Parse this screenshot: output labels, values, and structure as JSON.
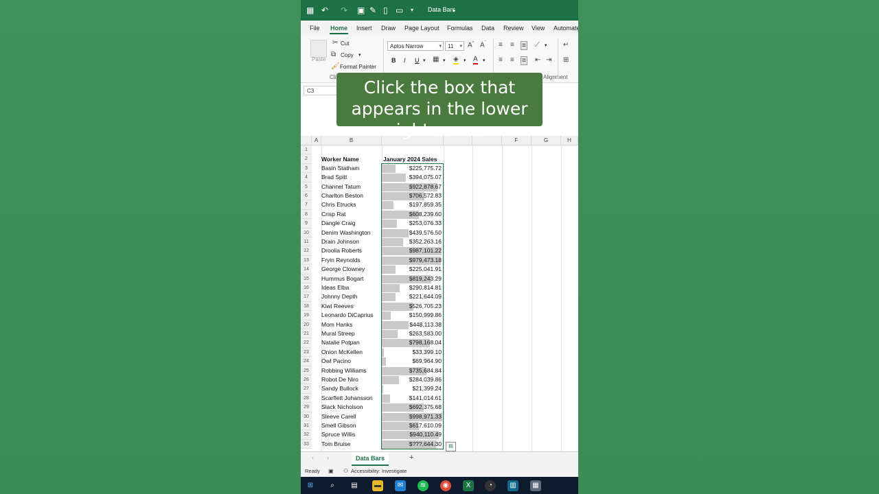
{
  "titlebar": {
    "workbook_title": "Data Bars"
  },
  "menu": {
    "items": [
      "File",
      "Home",
      "Insert",
      "Draw",
      "Page Layout",
      "Formulas",
      "Data",
      "Review",
      "View",
      "Automate"
    ]
  },
  "ribbon": {
    "paste_label": "Paste",
    "cut_label": "Cut",
    "copy_label": "Copy",
    "format_painter_label": "Format Painter",
    "clipboard_group": "Clipboard",
    "font_name": "Aptos Narrow",
    "font_size": "11",
    "alignment_group": "Alignment",
    "bold": "B",
    "italic": "I",
    "underline": "U"
  },
  "namebox": {
    "value": "C3"
  },
  "overlay": {
    "lines": [
      "Click the box that",
      "appears in the lower",
      "right corner"
    ]
  },
  "columns": [
    "A",
    "B",
    "F",
    "G",
    "H"
  ],
  "sheet": {
    "header_b": "Worker Name",
    "header_c": "January 2024 Sales",
    "rows": [
      {
        "name": "Basin Statham",
        "sales": "$225,775.72",
        "v": 225775.72
      },
      {
        "name": "Brad Spitt",
        "sales": "$394,075.07",
        "v": 394075.07
      },
      {
        "name": "Channel Tatum",
        "sales": "$922,878.67",
        "v": 922878.67
      },
      {
        "name": "Charlton Beston",
        "sales": "$706,572.83",
        "v": 706572.83
      },
      {
        "name": "Chris Etrucks",
        "sales": "$197,859.35",
        "v": 197859.35
      },
      {
        "name": "Crisp Rat",
        "sales": "$608,239.60",
        "v": 608239.6
      },
      {
        "name": "Dangle Craig",
        "sales": "$253,076.33",
        "v": 253076.33
      },
      {
        "name": "Denim Washington",
        "sales": "$439,576.50",
        "v": 439576.5
      },
      {
        "name": "Drain Johnson",
        "sales": "$352,263.16",
        "v": 352263.16
      },
      {
        "name": "Droolia Roberts",
        "sales": "$987,101.22",
        "v": 987101.22
      },
      {
        "name": "Fryin Reynolds",
        "sales": "$979,473.18",
        "v": 979473.18
      },
      {
        "name": "George Clowney",
        "sales": "$225,041.91",
        "v": 225041.91
      },
      {
        "name": "Hummus Bogart",
        "sales": "$819,243.29",
        "v": 819243.29
      },
      {
        "name": "Ideas Elba",
        "sales": "$290,814.81",
        "v": 290814.81
      },
      {
        "name": "Johnny Depth",
        "sales": "$221,644.09",
        "v": 221644.09
      },
      {
        "name": "Kiwi Reeves",
        "sales": "$526,705.23",
        "v": 526705.23
      },
      {
        "name": "Leonardo DiCaprius",
        "sales": "$150,999.86",
        "v": 150999.86
      },
      {
        "name": "Mom Hanks",
        "sales": "$448,113.38",
        "v": 448113.38
      },
      {
        "name": "Mural Streep",
        "sales": "$263,583.00",
        "v": 263583.0
      },
      {
        "name": "Natalie Potpan",
        "sales": "$798,168.04",
        "v": 798168.04
      },
      {
        "name": "Onion McKellen",
        "sales": "$33,399.10",
        "v": 33399.1
      },
      {
        "name": "Owl Pacino",
        "sales": "$69,964.90",
        "v": 69964.9
      },
      {
        "name": "Robbing Williams",
        "sales": "$735,684.84",
        "v": 735684.84
      },
      {
        "name": "Robot De Niro",
        "sales": "$284,039.86",
        "v": 284039.86
      },
      {
        "name": "Sandy Bullock",
        "sales": "$21,399.24",
        "v": 21399.24
      },
      {
        "name": "Scarflett Johansson",
        "sales": "$141,014.61",
        "v": 141014.61
      },
      {
        "name": "Slack Nicholson",
        "sales": "$692,375.68",
        "v": 692375.68
      },
      {
        "name": "Sleeve Carell",
        "sales": "$998,971.33",
        "v": 998971.33
      },
      {
        "name": "Smell Gibson",
        "sales": "$617,610.09",
        "v": 617610.09
      },
      {
        "name": "Spruce Willis",
        "sales": "$940,110.49",
        "v": 940110.49
      },
      {
        "name": "Tom Bruise",
        "sales": "$???,644.30",
        "v": 900000.0
      }
    ]
  },
  "tabs": {
    "active": "Data Bars",
    "add": "+"
  },
  "status": {
    "ready": "Ready",
    "accessibility": "Accessibility: Investigate"
  },
  "colors": {
    "excel_green": "#1e7145",
    "bar_fill": "#c9c9c9",
    "overlay_bg": "#4b7a3f"
  }
}
